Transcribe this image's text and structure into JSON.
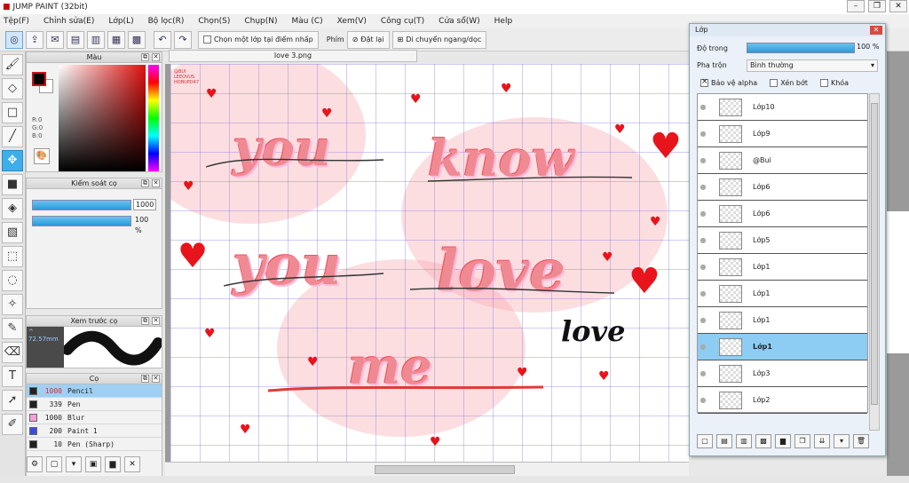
{
  "window": {
    "title": "JUMP PAINT (32bit)"
  },
  "menu": [
    "Tệp(F)",
    "Chỉnh sửa(E)",
    "Lớp(L)",
    "Bộ lọc(R)",
    "Chọn(S)",
    "Chụp(N)",
    "Màu (C)",
    "Xem(V)",
    "Công cụ(T)",
    "Cửa sổ(W)",
    "Help"
  ],
  "toolbar": {
    "select_layer_label": "Chọn một lớp tại điểm nhấp",
    "shortcut_label": "Phím",
    "reset_label": "Đặt lại",
    "move_label": "Di chuyển ngang/dọc"
  },
  "panels": {
    "color_title": "Màu",
    "color_rgb": [
      "R:0",
      "G:0",
      "B:0"
    ],
    "brush_control_title": "Kiểm soát cọ",
    "brush_size": "1000",
    "brush_opacity": "100 %",
    "preview_title": "Xem trước cọ",
    "preview_size": "72.57mm",
    "brush_list_title": "Cọ",
    "brushes": [
      {
        "size": "1000",
        "name": "Pencil",
        "color": "#222222",
        "selected": true
      },
      {
        "size": "339",
        "name": "Pen",
        "color": "#222222",
        "selected": false
      },
      {
        "size": "1000",
        "name": "Blur",
        "color": "#f5a0d8",
        "selected": false
      },
      {
        "size": "200",
        "name": "Paint 1",
        "color": "#3a4fd9",
        "selected": false
      },
      {
        "size": "10",
        "name": "Pen (Sharp)",
        "color": "#222222",
        "selected": false
      }
    ]
  },
  "document": {
    "tab_title": "love 3.png",
    "canvas_text": [
      "you",
      "know",
      "you",
      "love",
      "me",
      "love"
    ],
    "watermark": [
      "@BUI",
      "LEEOVUS",
      "HOBUPD47"
    ]
  },
  "layers_window": {
    "title": "Lớp",
    "opacity_label": "Độ trong",
    "opacity_value": "100 %",
    "blend_label": "Pha trộn",
    "blend_value": "Bình thường",
    "protect_alpha": "Bảo vệ alpha",
    "clip": "Xén bớt",
    "lock": "Khóa",
    "layers": [
      {
        "name": "Lớp10",
        "selected": false
      },
      {
        "name": "Lớp9",
        "selected": false
      },
      {
        "name": "@Bui",
        "selected": false
      },
      {
        "name": "Lớp6",
        "selected": false
      },
      {
        "name": "Lớp6",
        "selected": false
      },
      {
        "name": "Lớp5",
        "selected": false
      },
      {
        "name": "Lớp1",
        "selected": false
      },
      {
        "name": "Lớp1",
        "selected": false
      },
      {
        "name": "Lớp1",
        "selected": false
      },
      {
        "name": "Lớp1",
        "selected": true
      },
      {
        "name": "Lớp3",
        "selected": false
      },
      {
        "name": "Lớp2",
        "selected": false
      }
    ]
  },
  "colors": {
    "accent": "#3daee9",
    "heart": "#e8141b",
    "selection": "#8dcdf3"
  }
}
